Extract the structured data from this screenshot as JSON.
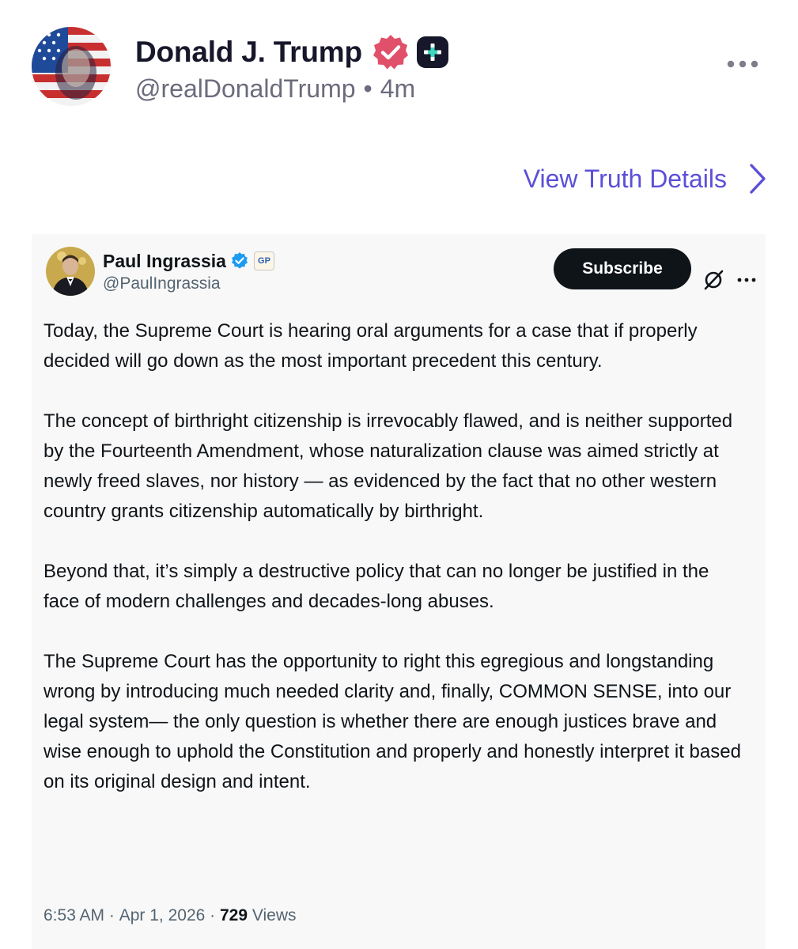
{
  "post": {
    "author_name": "Donald J. Trump",
    "handle": "@realDonaldTrump",
    "separator": "•",
    "time_ago": "4m",
    "view_details_label": "View Truth Details"
  },
  "embed": {
    "author_name": "Paul Ingrassia",
    "badge_text": "GP",
    "handle": "@PaulIngrassia",
    "subscribe_label": "Subscribe",
    "paragraphs": [
      "Today, the Supreme Court is hearing oral arguments for a case that if properly decided will go down as the most important precedent this century.",
      "The concept of birthright citizenship is irrevocably flawed, and is neither supported by the Fourteenth Amendment, whose naturalization clause was aimed strictly at newly freed slaves, nor history — as evidenced by the fact that no other western country grants citizenship automatically by birthright.",
      "Beyond that, it’s simply a destructive policy that can no longer be justified in the face of modern challenges and decades-long abuses.",
      "The Supreme Court has the opportunity to right this egregious and longstanding wrong by introducing much needed clarity and, finally, COMMON SENSE, into our legal system— the only question is whether there are enough justices brave and wise enough to uphold the Constitution and properly and honestly interpret it based on its original design and intent."
    ],
    "time": "6:53 AM",
    "date": "Apr 1, 2026",
    "meta_sep": " · ",
    "views_count": "729",
    "views_label": "Views"
  },
  "colors": {
    "accent_purple": "#5b4fd8",
    "verified_pink": "#e0506a",
    "x_verified_blue": "#1d9bf0",
    "card_bg": "#f8f8f8"
  },
  "icons": {
    "top_avatar": "flag-portrait-avatar",
    "verified": "verified-badge-icon",
    "plus": "plus-badge-icon",
    "more": "more-horizontal-icon",
    "chevron": "chevron-right-icon",
    "x_verified": "verified-check-icon",
    "grok": "grok-icon"
  }
}
